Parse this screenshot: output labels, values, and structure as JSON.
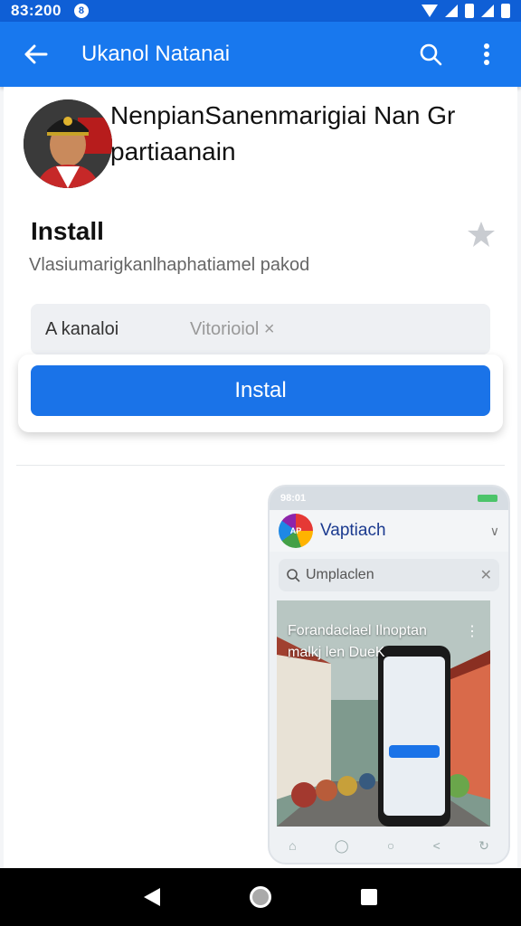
{
  "status_bar": {
    "time": "83:200",
    "notification_badge": "8"
  },
  "app_bar": {
    "title": "Ukanol Natanai",
    "back_icon": "arrow-left-icon",
    "search_icon": "search-icon",
    "menu_icon": "more-vertical-icon"
  },
  "profile": {
    "name": "NenpianSanenmarigiai Nan Gr partiaanain"
  },
  "install_section": {
    "title": "Install",
    "subtitle": "Vlasiumarigkanlhaphatiamel pakod",
    "field_label": "A kanaloi",
    "field_value": "Vitorioiol ×",
    "button_label": "Instal"
  },
  "preview": {
    "status_time": "98:01",
    "app_name": "Vaptiach",
    "logo_text": "AP",
    "search_placeholder": "Umplaclen",
    "photo_caption": "Forandaclael Ilnoptan malkj len DueK"
  },
  "colors": {
    "primary": "#1a73e8",
    "appbar": "#1878ee",
    "statusbar": "#0f5fd6"
  }
}
